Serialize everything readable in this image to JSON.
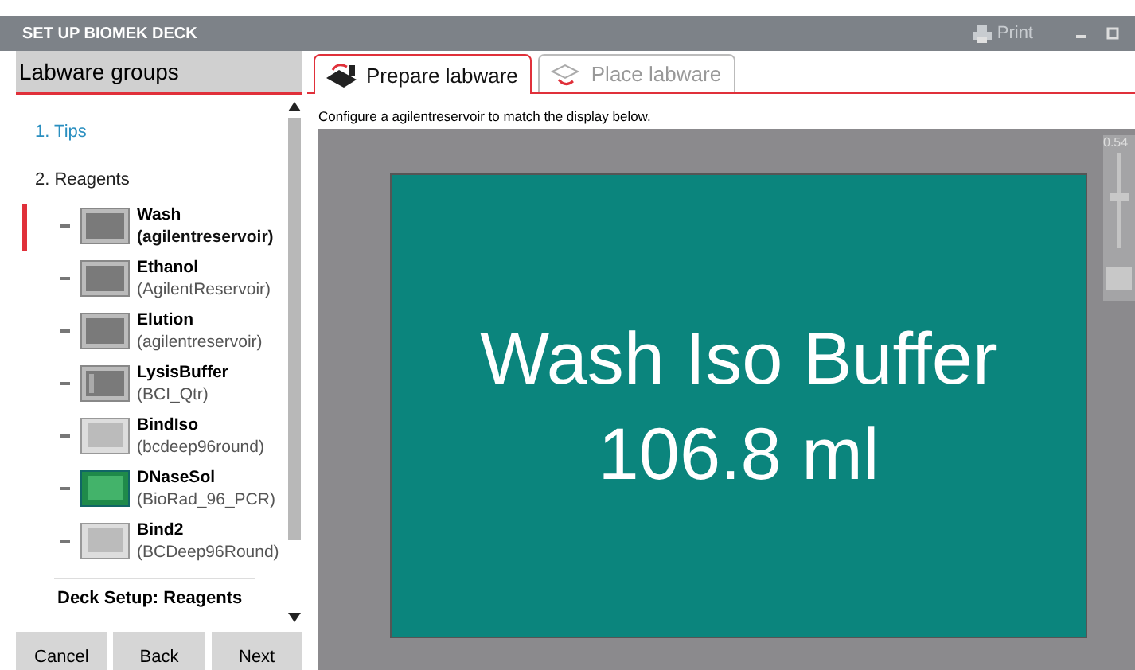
{
  "window": {
    "title": "SET UP BIOMEK DECK",
    "print": "Print"
  },
  "sidebar": {
    "title": "Labware groups",
    "groups": [
      {
        "label": "1. Tips",
        "selected": false
      },
      {
        "label": "2. Reagents",
        "selected": true
      }
    ],
    "items": [
      {
        "name": "Wash",
        "labware": "(agilentreservoir)",
        "kind": "reservoir",
        "selected": true
      },
      {
        "name": "Ethanol",
        "labware": "(AgilentReservoir)",
        "kind": "reservoir",
        "selected": false
      },
      {
        "name": "Elution",
        "labware": "(agilentreservoir)",
        "kind": "reservoir",
        "selected": false
      },
      {
        "name": "LysisBuffer",
        "labware": "(BCI_Qtr)",
        "kind": "quarter",
        "selected": false
      },
      {
        "name": "BindIso",
        "labware": "(bcdeep96round)",
        "kind": "plate",
        "selected": false
      },
      {
        "name": "DNaseSol",
        "labware": "(BioRad_96_PCR)",
        "kind": "pcr",
        "selected": false
      },
      {
        "name": "Bind2",
        "labware": "(BCDeep96Round)",
        "kind": "plate",
        "selected": false
      }
    ],
    "footer": "Deck Setup: Reagents",
    "buttons": [
      "Cancel",
      "Back",
      "Next"
    ]
  },
  "tabs": [
    {
      "label": "Prepare labware",
      "selected": true
    },
    {
      "label": "Place labware",
      "selected": false
    }
  ],
  "instruction": "Configure a agilentreservoir to match the display below.",
  "display": {
    "lines": [
      "Wash Iso Buffer",
      "106.8 ml"
    ],
    "color": "#0b857d"
  },
  "zoom": {
    "reading": "0.54",
    "level": 0.54
  }
}
